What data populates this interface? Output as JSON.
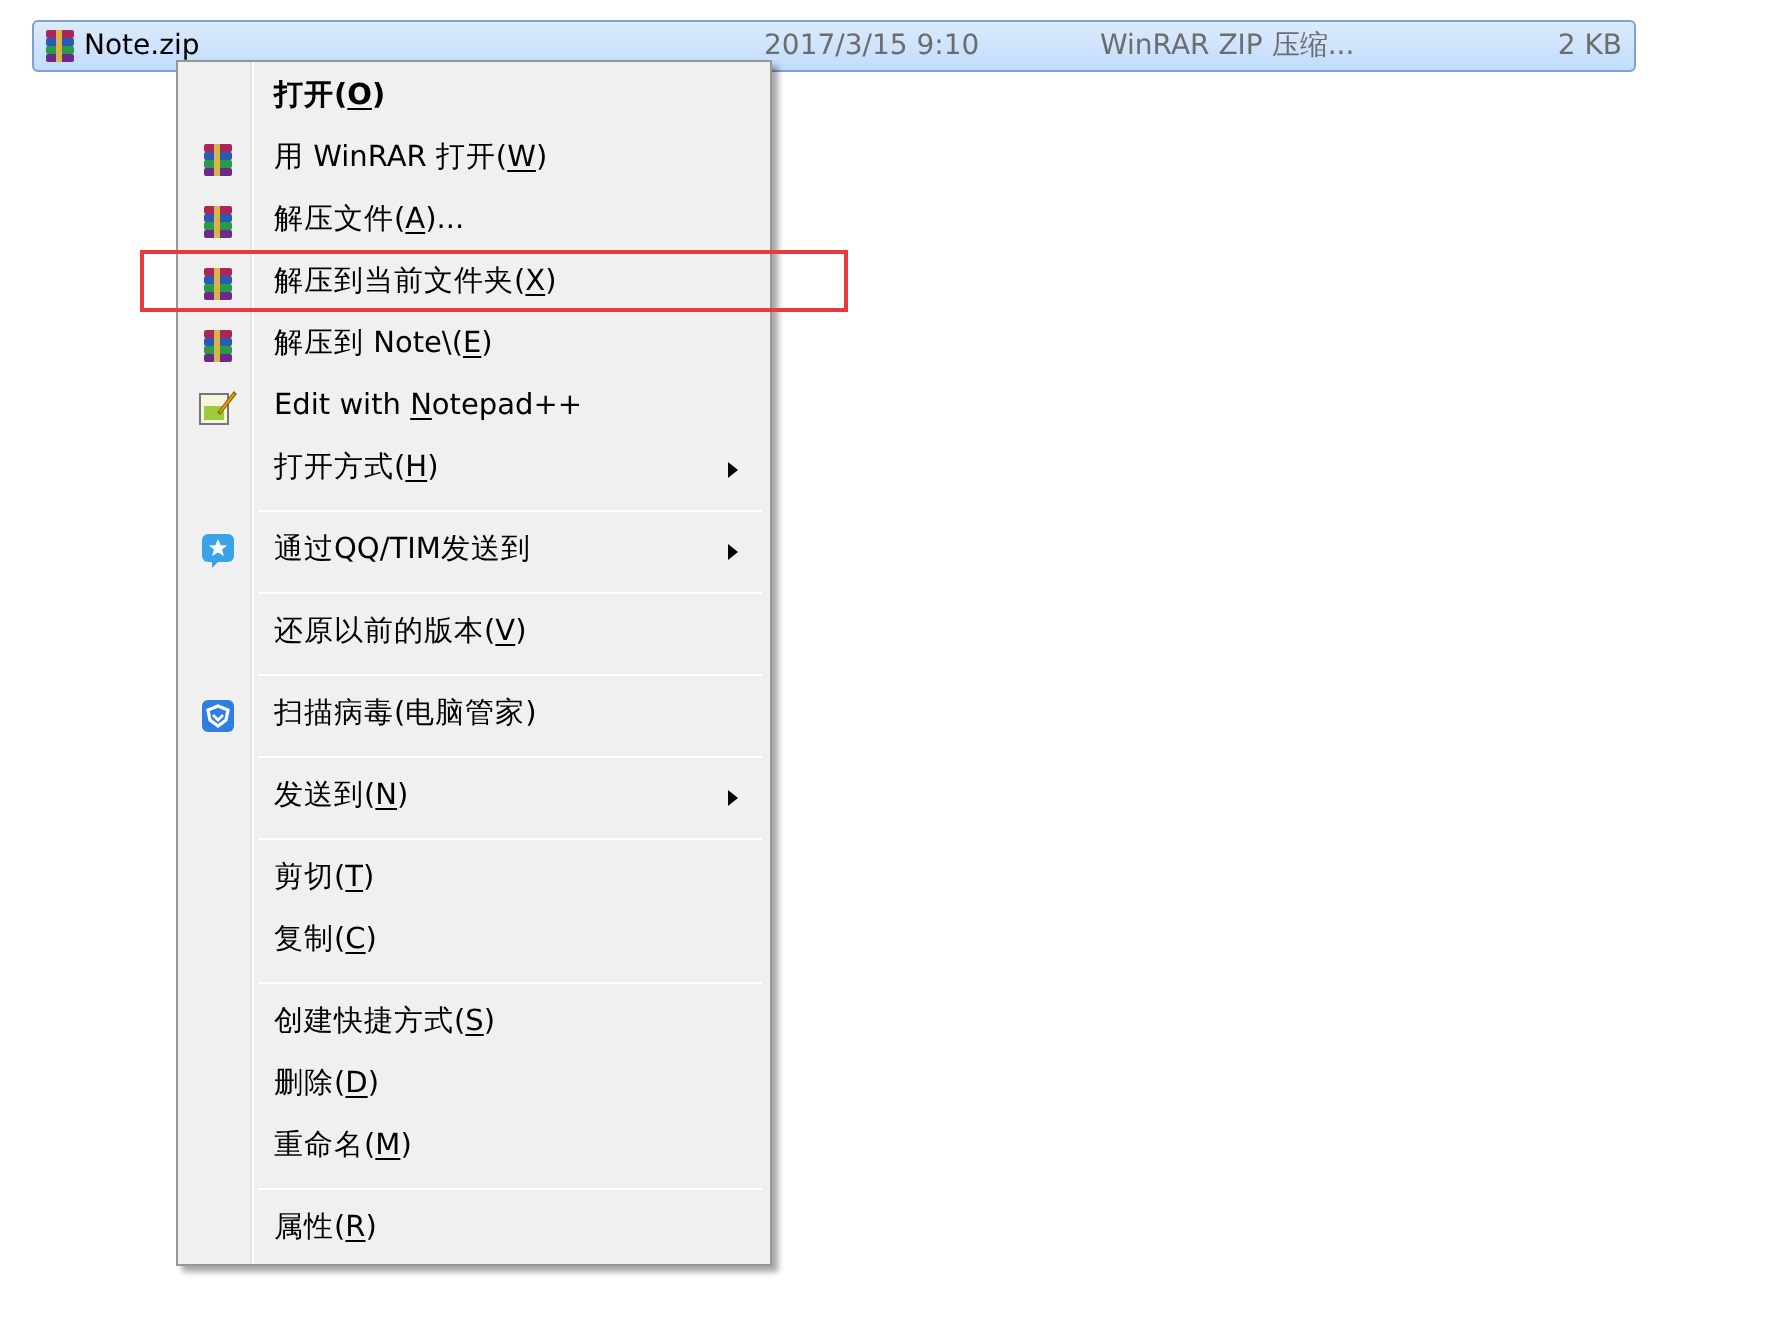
{
  "file_row": {
    "name": "Note.zip",
    "date": "2017/3/15 9:10",
    "type": "WinRAR ZIP 压缩...",
    "size": "2 KB",
    "selected": true
  },
  "menu": [
    {
      "kind": "item",
      "before": "打开(",
      "key": "O",
      "after": ")",
      "default": true,
      "submenu": false,
      "highlighted": false
    },
    {
      "kind": "winrar",
      "before": "用 WinRAR 打开(",
      "key": "W",
      "after": ")",
      "default": false,
      "submenu": false,
      "highlighted": false
    },
    {
      "kind": "winrar",
      "before": "解压文件(",
      "key": "A",
      "after": ")...",
      "default": false,
      "submenu": false,
      "highlighted": false
    },
    {
      "kind": "winrar",
      "before": "解压到当前文件夹(",
      "key": "X",
      "after": ")",
      "default": false,
      "submenu": false,
      "highlighted": true
    },
    {
      "kind": "winrar",
      "before": "解压到 Note\\(",
      "key": "E",
      "after": ")",
      "default": false,
      "submenu": false,
      "highlighted": false
    },
    {
      "kind": "notepad",
      "before": "Edit with ",
      "key": "N",
      "after": "otepad++",
      "default": false,
      "submenu": false,
      "highlighted": false
    },
    {
      "kind": "item",
      "before": "打开方式(",
      "key": "H",
      "after": ")",
      "default": false,
      "submenu": true,
      "highlighted": false
    },
    {
      "kind": "separator"
    },
    {
      "kind": "qq",
      "before": "通过QQ/TIM发送到",
      "default": false,
      "submenu": true,
      "highlighted": false
    },
    {
      "kind": "separator"
    },
    {
      "kind": "item",
      "before": "还原以前的版本(",
      "key": "V",
      "after": ")",
      "default": false,
      "submenu": false,
      "highlighted": false
    },
    {
      "kind": "separator"
    },
    {
      "kind": "shield",
      "before": "扫描病毒(电脑管家)",
      "default": false,
      "submenu": false,
      "highlighted": false
    },
    {
      "kind": "separator"
    },
    {
      "kind": "item",
      "before": "发送到(",
      "key": "N",
      "after": ")",
      "default": false,
      "submenu": true,
      "highlighted": false
    },
    {
      "kind": "separator"
    },
    {
      "kind": "item",
      "before": "剪切(",
      "key": "T",
      "after": ")",
      "default": false,
      "submenu": false,
      "highlighted": false
    },
    {
      "kind": "item",
      "before": "复制(",
      "key": "C",
      "after": ")",
      "default": false,
      "submenu": false,
      "highlighted": false
    },
    {
      "kind": "separator"
    },
    {
      "kind": "item",
      "before": "创建快捷方式(",
      "key": "S",
      "after": ")",
      "default": false,
      "submenu": false,
      "highlighted": false
    },
    {
      "kind": "item",
      "before": "删除(",
      "key": "D",
      "after": ")",
      "default": false,
      "submenu": false,
      "highlighted": false
    },
    {
      "kind": "item",
      "before": "重命名(",
      "key": "M",
      "after": ")",
      "default": false,
      "submenu": false,
      "highlighted": false
    },
    {
      "kind": "separator"
    },
    {
      "kind": "item",
      "before": "属性(",
      "key": "R",
      "after": ")",
      "default": false,
      "submenu": false,
      "highlighted": false
    }
  ]
}
